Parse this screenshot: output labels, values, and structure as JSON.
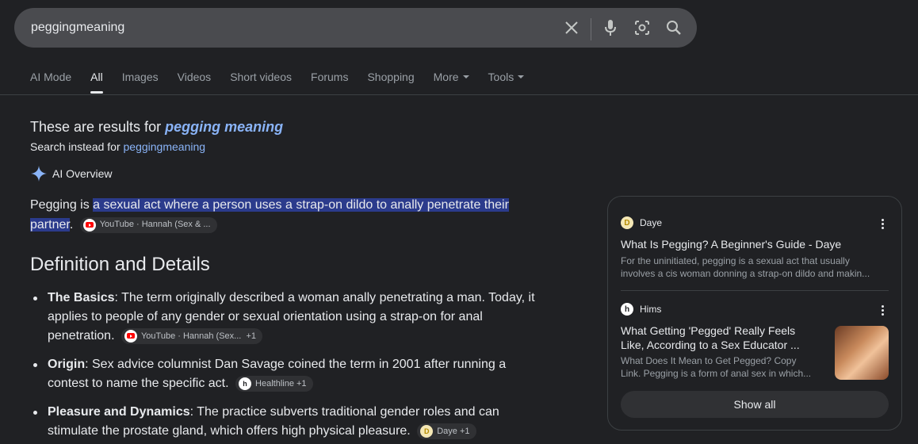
{
  "search": {
    "query": "peggingmeaning"
  },
  "tabs": [
    {
      "label": "AI Mode"
    },
    {
      "label": "All"
    },
    {
      "label": "Images"
    },
    {
      "label": "Videos"
    },
    {
      "label": "Short videos"
    },
    {
      "label": "Forums"
    },
    {
      "label": "Shopping"
    },
    {
      "label": "More"
    },
    {
      "label": "Tools"
    }
  ],
  "correction": {
    "prefix": "These are results for ",
    "corrected": "pegging meaning",
    "instead_prefix": "Search instead for ",
    "instead_link": "peggingmeaning"
  },
  "ai_overview": {
    "label": "AI Overview",
    "intro_lead": "Pegging is ",
    "intro_highlight": "a sexual act where a person uses a strap-on dildo to anally penetrate their partner",
    "intro_tail": ".",
    "intro_chip": "YouTube · Hannah (Sex & ...",
    "heading": "Definition and Details",
    "bullets": [
      {
        "term": "The Basics",
        "text": ": The term originally described a woman anally penetrating a man. Today, it applies to people of any gender or sexual orientation using a strap-on for anal penetration.",
        "chip": "YouTube · Hannah (Sex...",
        "chip_extra": "+1"
      },
      {
        "term": "Origin",
        "text": ": Sex advice columnist Dan Savage coined the term in 2001 after running a contest to name the specific act.",
        "chip": "Healthline",
        "chip_extra": "+1"
      },
      {
        "term": "Pleasure and Dynamics",
        "text": ": The practice subverts traditional gender roles and can stimulate the prostate gland, which offers high physical pleasure.",
        "chip": "Daye",
        "chip_extra": "+1"
      }
    ]
  },
  "sources_card": {
    "items": [
      {
        "source": "Daye",
        "title": "What Is Pegging? A Beginner's Guide - Daye",
        "snippet_1": "For the uninitiated, pegging is a sexual act that usually",
        "snippet_2": "involves a cis woman donning a strap-on dildo and makin..."
      },
      {
        "source": "Hims",
        "title_1": "What Getting 'Pegged' Really Feels",
        "title_2": "Like, According to a Sex Educator ...",
        "snippet_1": "What Does It Mean to Get Pegged? Copy",
        "snippet_2": "Link. Pegging is a form of anal sex in which..."
      }
    ],
    "show_all": "Show all"
  }
}
